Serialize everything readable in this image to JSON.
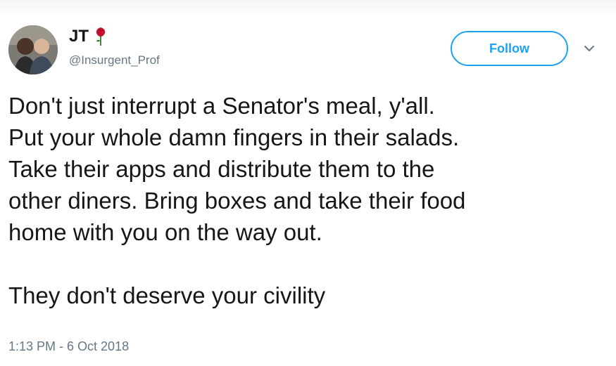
{
  "tweet": {
    "author": {
      "display_name": "JT",
      "handle": "@Insurgent_Prof",
      "name_emoji_icon": "rose-icon",
      "avatar_icon": "profile-photo"
    },
    "follow_label": "Follow",
    "menu_icon": "chevron-down-icon",
    "body_lines": [
      "Don't just interrupt a Senator's meal, y'all.",
      "Put your whole damn fingers in their salads.",
      "Take their apps and distribute them to the",
      "other diners. Bring boxes and take their food",
      "home with you on the way out."
    ],
    "closing_line": "They don't deserve your civility",
    "timestamp": "1:13 PM - 6 Oct 2018"
  },
  "colors": {
    "accent": "#1da1f2",
    "text": "#14171a",
    "secondary_text": "#657786",
    "rose": "#c8102e"
  }
}
